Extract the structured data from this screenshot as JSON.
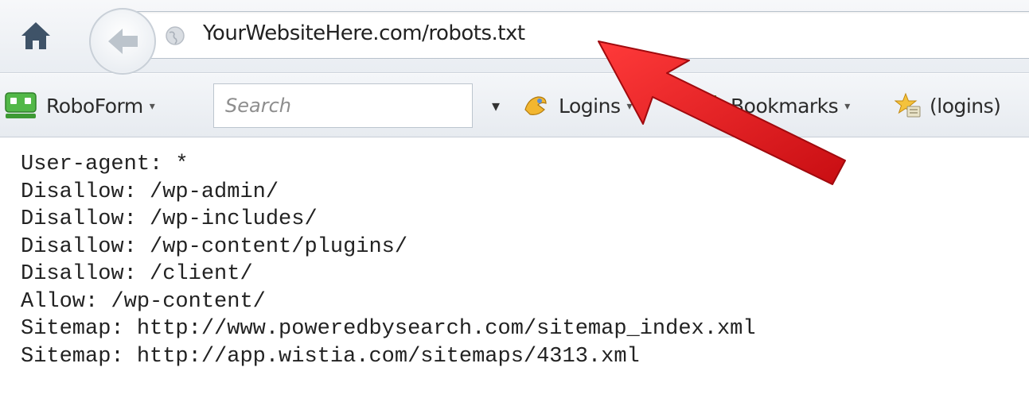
{
  "navigation": {
    "url": "YourWebsiteHere.com/robots.txt",
    "home_icon": "home-icon",
    "back_icon": "back-arrow-icon",
    "site_icon": "globe-icon"
  },
  "toolbar": {
    "roboform_label": "RoboForm",
    "search_placeholder": "Search",
    "logins_label": "Logins",
    "bookmarks_label": "Bookmarks",
    "logins_folder_label": "(logins)",
    "caret": "▾"
  },
  "robots_txt": {
    "lines": [
      "User-agent: *",
      "Disallow: /wp-admin/",
      "Disallow: /wp-includes/",
      "Disallow: /wp-content/plugins/",
      "Disallow: /client/",
      "Allow: /wp-content/",
      "Sitemap: http://www.poweredbysearch.com/sitemap_index.xml",
      "Sitemap: http://app.wistia.com/sitemaps/4313.xml"
    ]
  },
  "annotation": {
    "arrow_color": "#e8141a",
    "arrow_icon": "red-pointer-arrow"
  }
}
